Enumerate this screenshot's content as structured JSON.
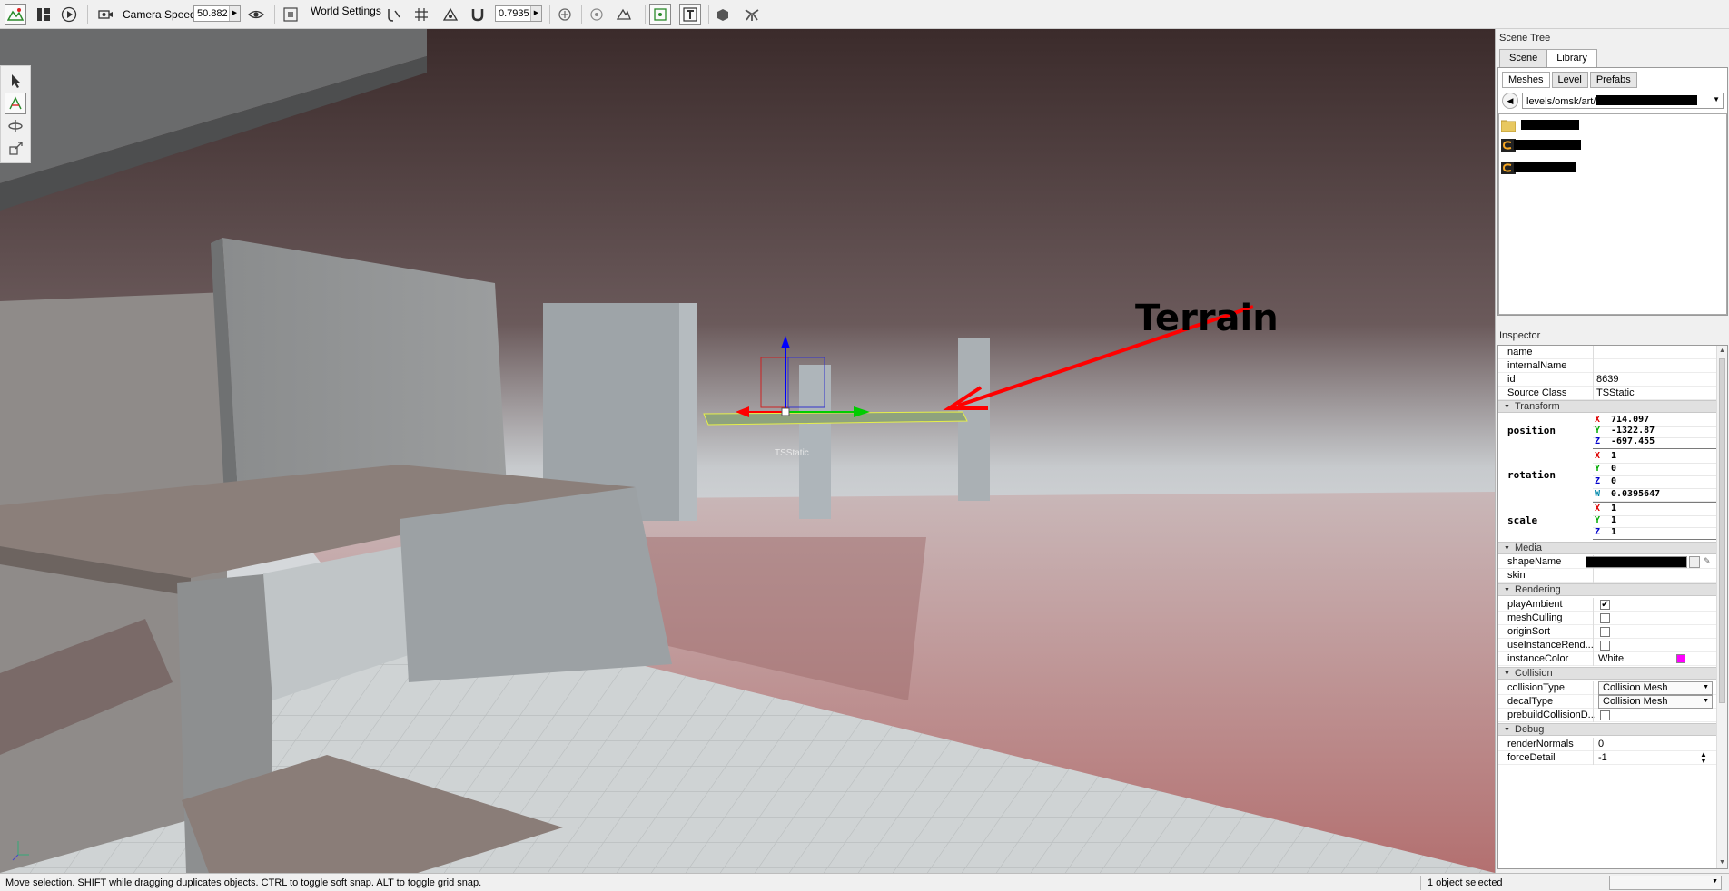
{
  "toolbar": {
    "camera_speed_label": "Camera Speed",
    "camera_speed_value": "50.882",
    "world_settings_label": "World Settings",
    "snap_value": "0.7935"
  },
  "viewport": {
    "annotation_text": "Terrain",
    "object_label": "TSStatic"
  },
  "scene_tree": {
    "title": "Scene Tree",
    "tabs": [
      "Scene",
      "Library"
    ],
    "selected_tab": "Library",
    "subtabs": [
      "Meshes",
      "Level",
      "Prefabs"
    ],
    "selected_subtab": "Meshes",
    "path": "levels/omsk/art/"
  },
  "inspector": {
    "title": "Inspector",
    "fields": {
      "name_label": "name",
      "name_value": "",
      "internal_name_label": "internalName",
      "internal_name_value": "",
      "id_label": "id",
      "id_value": "8639",
      "source_class_label": "Source Class",
      "source_class_value": "TSStatic"
    },
    "groups": {
      "transform": "Transform",
      "media": "Media",
      "rendering": "Rendering",
      "collision": "Collision",
      "debug": "Debug"
    },
    "transform": {
      "position_label": "position",
      "position": {
        "x": "714.097",
        "y": "-1322.87",
        "z": "-697.455"
      },
      "rotation_label": "rotation",
      "rotation": {
        "x": "1",
        "y": "0",
        "z": "0",
        "w": "0.0395647"
      },
      "scale_label": "scale",
      "scale": {
        "x": "1",
        "y": "1",
        "z": "1"
      }
    },
    "axis_labels": {
      "x": "X",
      "y": "Y",
      "z": "Z",
      "w": "W"
    },
    "media": {
      "shape_name_label": "shapeName",
      "skin_label": "skin"
    },
    "rendering": {
      "play_ambient_label": "playAmbient",
      "play_ambient": true,
      "mesh_culling_label": "meshCulling",
      "mesh_culling": false,
      "origin_sort_label": "originSort",
      "origin_sort": false,
      "use_instance_label": "useInstanceRend...",
      "use_instance": false,
      "instance_color_label": "instanceColor",
      "instance_color_value": "White",
      "instance_color_swatch": "#ff00ff"
    },
    "collision": {
      "collision_type_label": "collisionType",
      "collision_type_value": "Collision Mesh",
      "decal_type_label": "decalType",
      "decal_type_value": "Collision Mesh",
      "prebuild_label": "prebuildCollisionD...",
      "prebuild": false
    },
    "debug": {
      "render_normals_label": "renderNormals",
      "render_normals_value": "0",
      "force_detail_label": "forceDetail",
      "force_detail_value": "-1"
    }
  },
  "statusbar": {
    "message": "Move selection.  SHIFT while dragging duplicates objects.  CTRL to toggle soft snap.  ALT to toggle grid snap.",
    "selection": "1 object selected"
  },
  "colors": {
    "annotation_arrow": "#ff0000",
    "gizmo_x": "#ff0000",
    "gizmo_y": "#00cc00",
    "gizmo_z": "#0000ff"
  }
}
